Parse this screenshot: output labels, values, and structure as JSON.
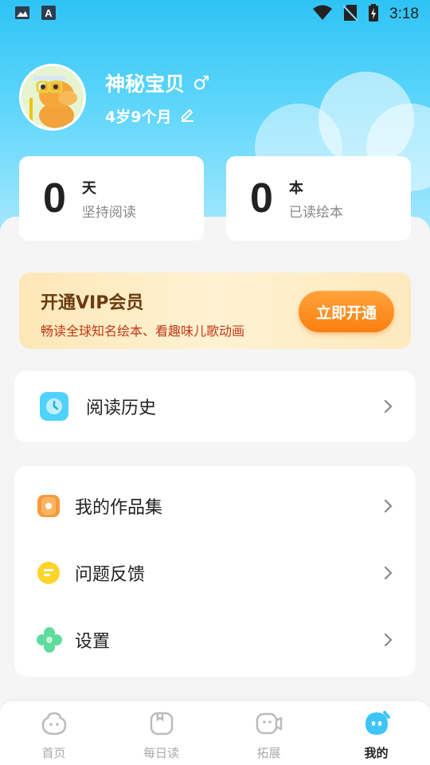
{
  "status_bar": {
    "time": "3:18",
    "left_icons": [
      "image-icon",
      "font-a-icon"
    ],
    "right_icons": [
      "wifi-icon",
      "no-sim-icon",
      "battery-charging-icon"
    ]
  },
  "profile": {
    "name": "神秘宝贝",
    "gender_symbol": "♂",
    "age": "4岁9个月",
    "avatar_icon": "dinosaur-avatar"
  },
  "stats": [
    {
      "number": "0",
      "unit": "天",
      "label": "坚持阅读"
    },
    {
      "number": "0",
      "unit": "本",
      "label": "已读绘本"
    }
  ],
  "vip": {
    "title": "开通VIP会员",
    "subtitle": "畅读全球知名绘本、看趣味儿歌动画",
    "button": "立即开通"
  },
  "menu_primary": [
    {
      "label": "阅读历史",
      "icon": "clock-icon"
    }
  ],
  "menu_secondary": [
    {
      "label": "我的作品集",
      "icon": "portfolio-icon"
    },
    {
      "label": "问题反馈",
      "icon": "feedback-icon"
    },
    {
      "label": "设置",
      "icon": "settings-flower-icon"
    }
  ],
  "bottom_nav": [
    {
      "label": "首页",
      "icon": "home-face-icon",
      "active": false
    },
    {
      "label": "每日读",
      "icon": "daily-read-icon",
      "active": false
    },
    {
      "label": "拓展",
      "icon": "expand-icon",
      "active": false
    },
    {
      "label": "我的",
      "icon": "mine-face-icon",
      "active": true
    }
  ],
  "colors": {
    "header_top": "#2ec3f4",
    "vip_button": "#fb7e10",
    "vip_subtitle": "#c0391a",
    "active_nav_icon": "#3dc5f7"
  }
}
